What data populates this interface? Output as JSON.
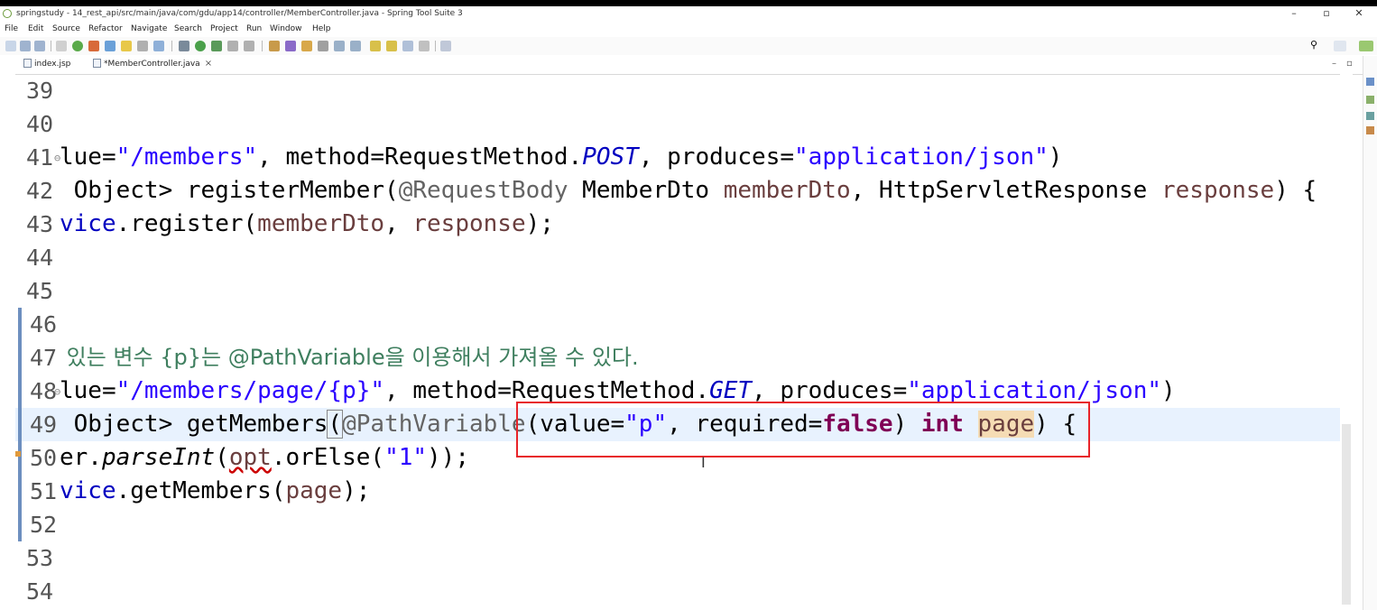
{
  "window": {
    "title": "springstudy - 14_rest_api/src/main/java/com/gdu/app14/controller/MemberController.java - Spring Tool Suite 3",
    "minimize": "–",
    "maximize": "▫",
    "close": "✕"
  },
  "menu": [
    "File",
    "Edit",
    "Source",
    "Refactor",
    "Navigate",
    "Search",
    "Project",
    "Run",
    "Window",
    "Help"
  ],
  "toolbar": {
    "search_icon": "search-icon"
  },
  "tabs": [
    {
      "label": "index.jsp",
      "active": false
    },
    {
      "label": "*MemberController.java",
      "active": true,
      "close": "×"
    }
  ],
  "editor": {
    "lines": [
      {
        "n": "39"
      },
      {
        "n": "40"
      },
      {
        "n": "41"
      },
      {
        "n": "42"
      },
      {
        "n": "43"
      },
      {
        "n": "44"
      },
      {
        "n": "45"
      },
      {
        "n": "46"
      },
      {
        "n": "47"
      },
      {
        "n": "48"
      },
      {
        "n": "49"
      },
      {
        "n": "50"
      },
      {
        "n": "51"
      },
      {
        "n": "52"
      },
      {
        "n": "53"
      },
      {
        "n": "54"
      }
    ],
    "code": {
      "l41_a": "lue=",
      "l41_b": "\"/members\"",
      "l41_c": ", method=RequestMethod.",
      "l41_d": "POST",
      "l41_e": ", produces=",
      "l41_f": "\"application/json\"",
      "l41_g": ")",
      "l42_a": " Object> registerMember(",
      "l42_b": "@RequestBody",
      "l42_c": " MemberDto ",
      "l42_d": "memberDto",
      "l42_e": ", HttpServletResponse ",
      "l42_f": "response",
      "l42_g": ") {",
      "l43_a": "vice",
      "l43_b": ".register(",
      "l43_c": "memberDto",
      "l43_d": ", ",
      "l43_e": "response",
      "l43_f": ");",
      "l47": " 있는 변수 {p}는 @PathVariable을 이용해서 가져올 수 있다.",
      "l48_a": "lue=",
      "l48_b": "\"/members/page/{p}\"",
      "l48_c": ", method=RequestMethod.",
      "l48_d": "GET",
      "l48_e": ", produces=",
      "l48_f": "\"application/json\"",
      "l48_g": ")",
      "l49_a": " Object> getMembers",
      "l49_b": "(",
      "l49_c": "@PathVariable",
      "l49_d": "(value=",
      "l49_e": "\"p\"",
      "l49_f": ", required=",
      "l49_g": "false",
      "l49_h": ") ",
      "l49_i": "int",
      "l49_j": " ",
      "l49_k": "page",
      "l49_l": ") {",
      "l50_a": "er.",
      "l50_b": "parseInt",
      "l50_c": "(",
      "l50_d": "opt",
      "l50_e": ".orElse(",
      "l50_f": "\"1\"",
      "l50_g": "));",
      "l51_a": "vice",
      "l51_b": ".getMembers(",
      "l51_c": "page",
      "l51_d": ");"
    }
  },
  "text_cursor": "I"
}
